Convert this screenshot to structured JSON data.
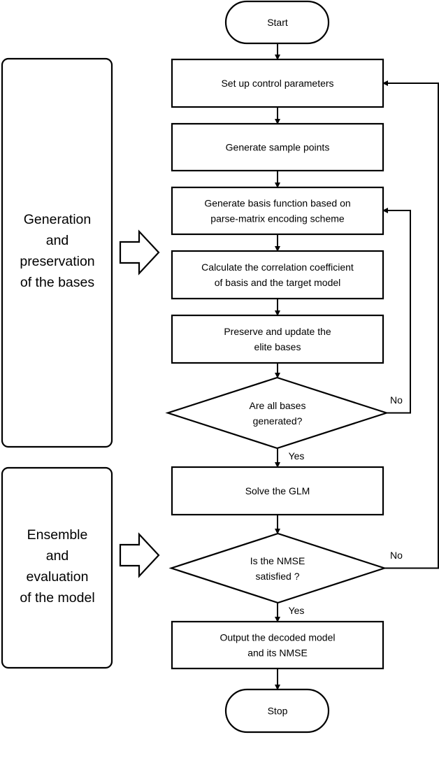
{
  "diagram": {
    "type": "flowchart",
    "colors": {
      "stroke": "#000000",
      "fill": "#ffffff",
      "text": "#000000"
    },
    "panels": [
      {
        "id": "panel-generation",
        "lines": [
          "Generation",
          "and",
          "preservation",
          "of the bases"
        ]
      },
      {
        "id": "panel-ensemble",
        "lines": [
          "Ensemble",
          "and",
          "evaluation",
          "of the model"
        ]
      }
    ],
    "nodes": [
      {
        "id": "start",
        "shape": "terminator",
        "lines": [
          "Start"
        ]
      },
      {
        "id": "setup",
        "shape": "process",
        "lines": [
          "Set up control parameters"
        ]
      },
      {
        "id": "sample",
        "shape": "process",
        "lines": [
          "Generate sample points"
        ]
      },
      {
        "id": "basis",
        "shape": "process",
        "lines": [
          "Generate basis function based on",
          "parse-matrix encoding scheme"
        ]
      },
      {
        "id": "correlation",
        "shape": "process",
        "lines": [
          "Calculate the correlation coefficient",
          "of basis and the target model"
        ]
      },
      {
        "id": "preserve",
        "shape": "process",
        "lines": [
          "Preserve and update the",
          "elite bases"
        ]
      },
      {
        "id": "decision-bases",
        "shape": "decision",
        "lines": [
          "Are all bases",
          "generated?"
        ]
      },
      {
        "id": "glm",
        "shape": "process",
        "lines": [
          "Solve the GLM"
        ]
      },
      {
        "id": "decision-nmse",
        "shape": "decision",
        "lines": [
          "Is the NMSE",
          "satisfied ?"
        ]
      },
      {
        "id": "output",
        "shape": "process",
        "lines": [
          "Output the decoded model",
          "and its NMSE"
        ]
      },
      {
        "id": "stop",
        "shape": "terminator",
        "lines": [
          "Stop"
        ]
      }
    ],
    "edges": [
      {
        "from": "start",
        "to": "setup",
        "label": ""
      },
      {
        "from": "setup",
        "to": "sample",
        "label": ""
      },
      {
        "from": "sample",
        "to": "basis",
        "label": ""
      },
      {
        "from": "basis",
        "to": "correlation",
        "label": ""
      },
      {
        "from": "correlation",
        "to": "preserve",
        "label": ""
      },
      {
        "from": "preserve",
        "to": "decision-bases",
        "label": ""
      },
      {
        "from": "decision-bases",
        "to": "basis",
        "label": "No"
      },
      {
        "from": "decision-bases",
        "to": "glm",
        "label": "Yes"
      },
      {
        "from": "glm",
        "to": "decision-nmse",
        "label": ""
      },
      {
        "from": "decision-nmse",
        "to": "setup",
        "label": "No"
      },
      {
        "from": "decision-nmse",
        "to": "output",
        "label": "Yes"
      },
      {
        "from": "output",
        "to": "stop",
        "label": ""
      }
    ],
    "phase_arrows": [
      {
        "from": "panel-generation",
        "to": "correlation"
      },
      {
        "from": "panel-ensemble",
        "to": "decision-nmse"
      }
    ]
  }
}
